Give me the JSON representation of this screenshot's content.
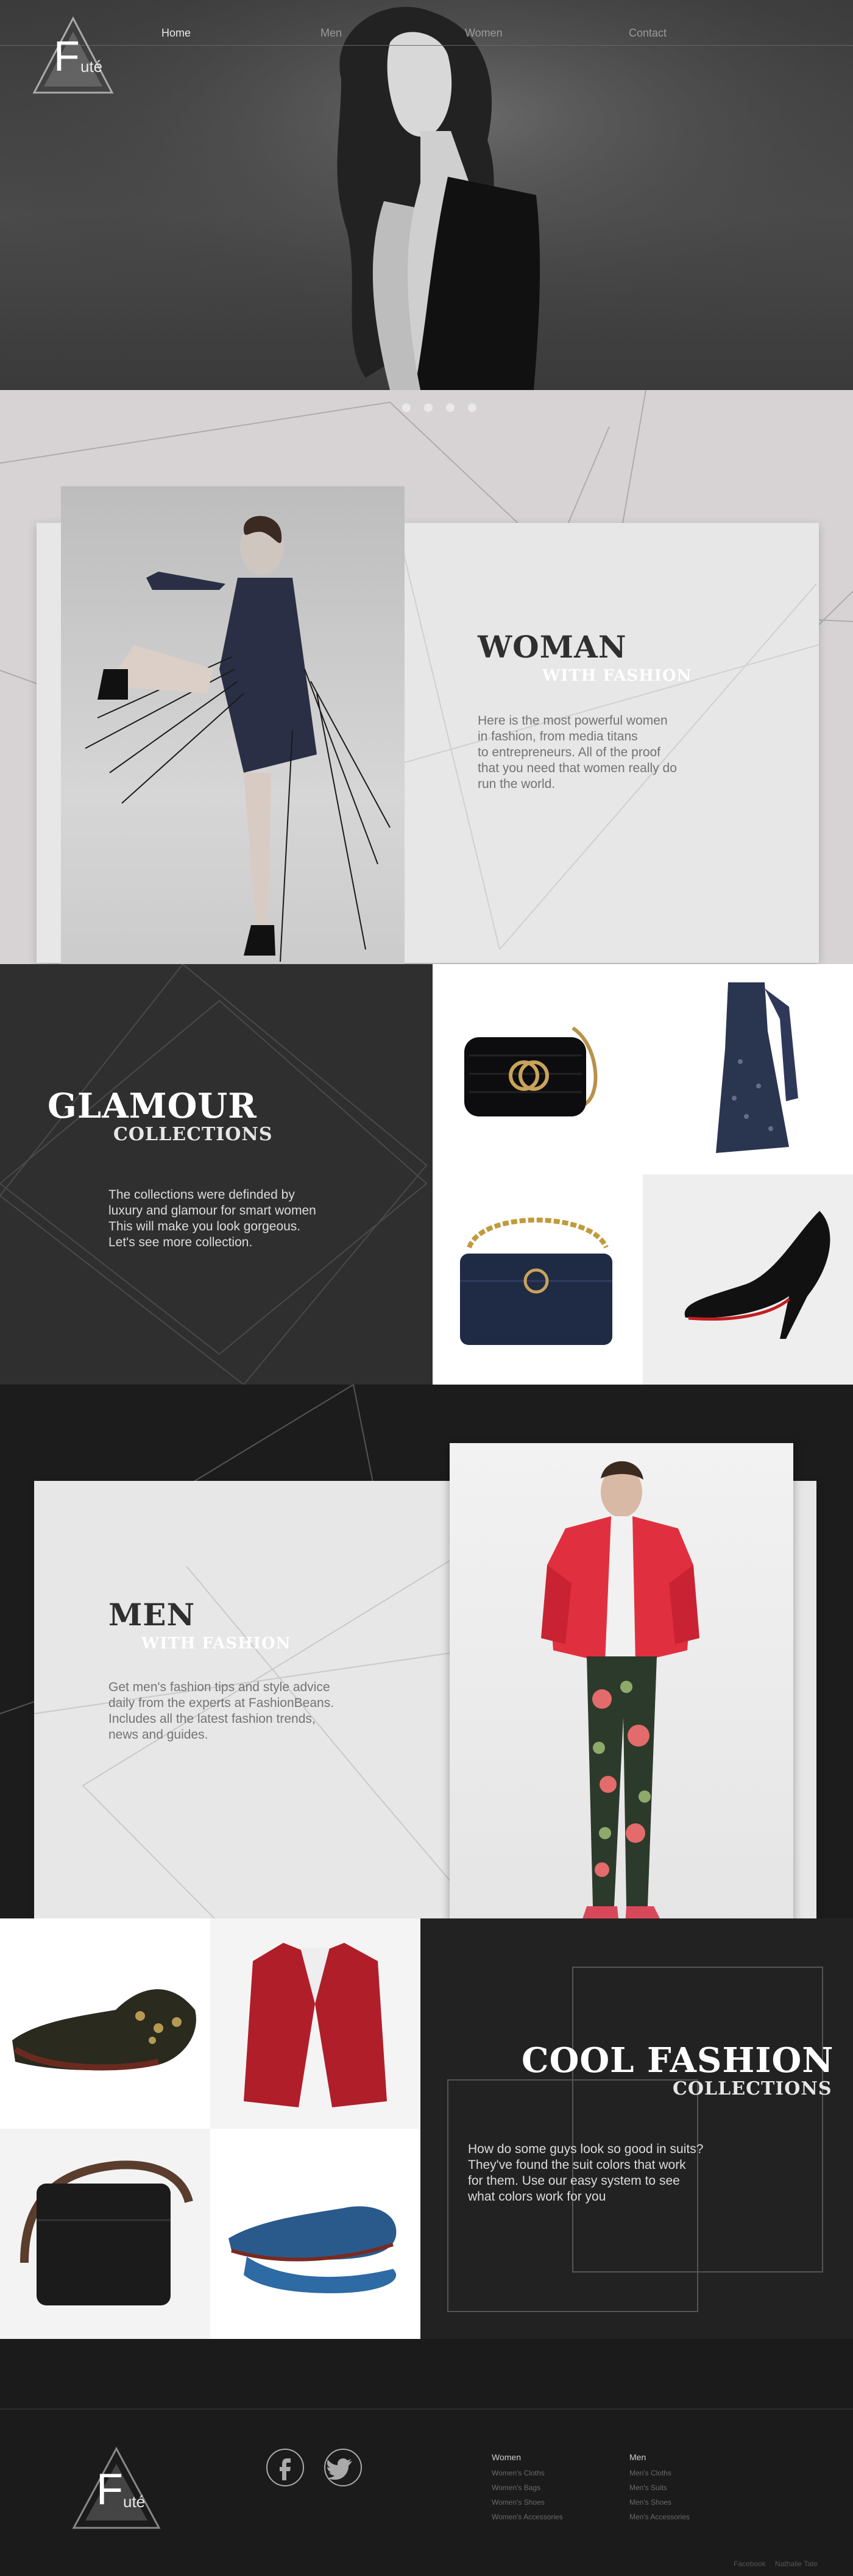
{
  "brand": {
    "logo_letter": "F",
    "logo_suffix": "uté"
  },
  "nav": {
    "items": [
      "Home",
      "Men",
      "Women",
      "Contact"
    ],
    "active": "Home"
  },
  "hero": {
    "slider_dots": 4
  },
  "woman": {
    "title": "WOMAN",
    "subtitle": "WITH FASHION",
    "text": [
      "Here is the most powerful women",
      "in fashion, from media titans",
      "to entrepreneurs. All of the proof",
      "that you need that women really do",
      "run the world."
    ]
  },
  "glamour": {
    "title": "GLAMOUR",
    "subtitle": "COLLECTIONS",
    "text": [
      "The collections were definded by",
      "luxury and glamour for smart women",
      "This will make you look gorgeous.",
      "Let's see more collection."
    ],
    "products": [
      "gucci-bag",
      "sequin-dress",
      "quilted-bag",
      "red-sole-heel"
    ]
  },
  "men": {
    "title": "MEN",
    "subtitle": "WITH FASHION",
    "text": [
      "Get men's fashion tips and style advice",
      "daily from the experts at FashionBeans.",
      "Includes all the latest fashion trends,",
      "news and guides."
    ]
  },
  "cool": {
    "title": "COOL FASHION",
    "subtitle": "COLLECTIONS",
    "text": [
      "How do some guys look so good in suits?",
      "They've found the suit colors that work",
      "for them. Use our easy system to see",
      "what colors work for you"
    ],
    "products": [
      "velvet-loafer",
      "red-blazer",
      "leather-bag",
      "blue-loafer"
    ]
  },
  "footer": {
    "social": [
      "facebook-icon",
      "twitter-icon"
    ],
    "women": {
      "title": "Women",
      "links": [
        "Women's Cloths",
        "Women's Bags",
        "Women's Shoes",
        "Women's Accessories"
      ]
    },
    "men": {
      "title": "Men",
      "links": [
        "Men's Cloths",
        "Men's Suits",
        "Men's Shoes",
        "Men's Accessories"
      ]
    },
    "bottom_links": [
      "Facebook",
      "Nathalie Tate"
    ]
  },
  "colors": {
    "accent_dark": "#2f2f2f",
    "card": "#e7e7e7",
    "hero": "#454545"
  }
}
